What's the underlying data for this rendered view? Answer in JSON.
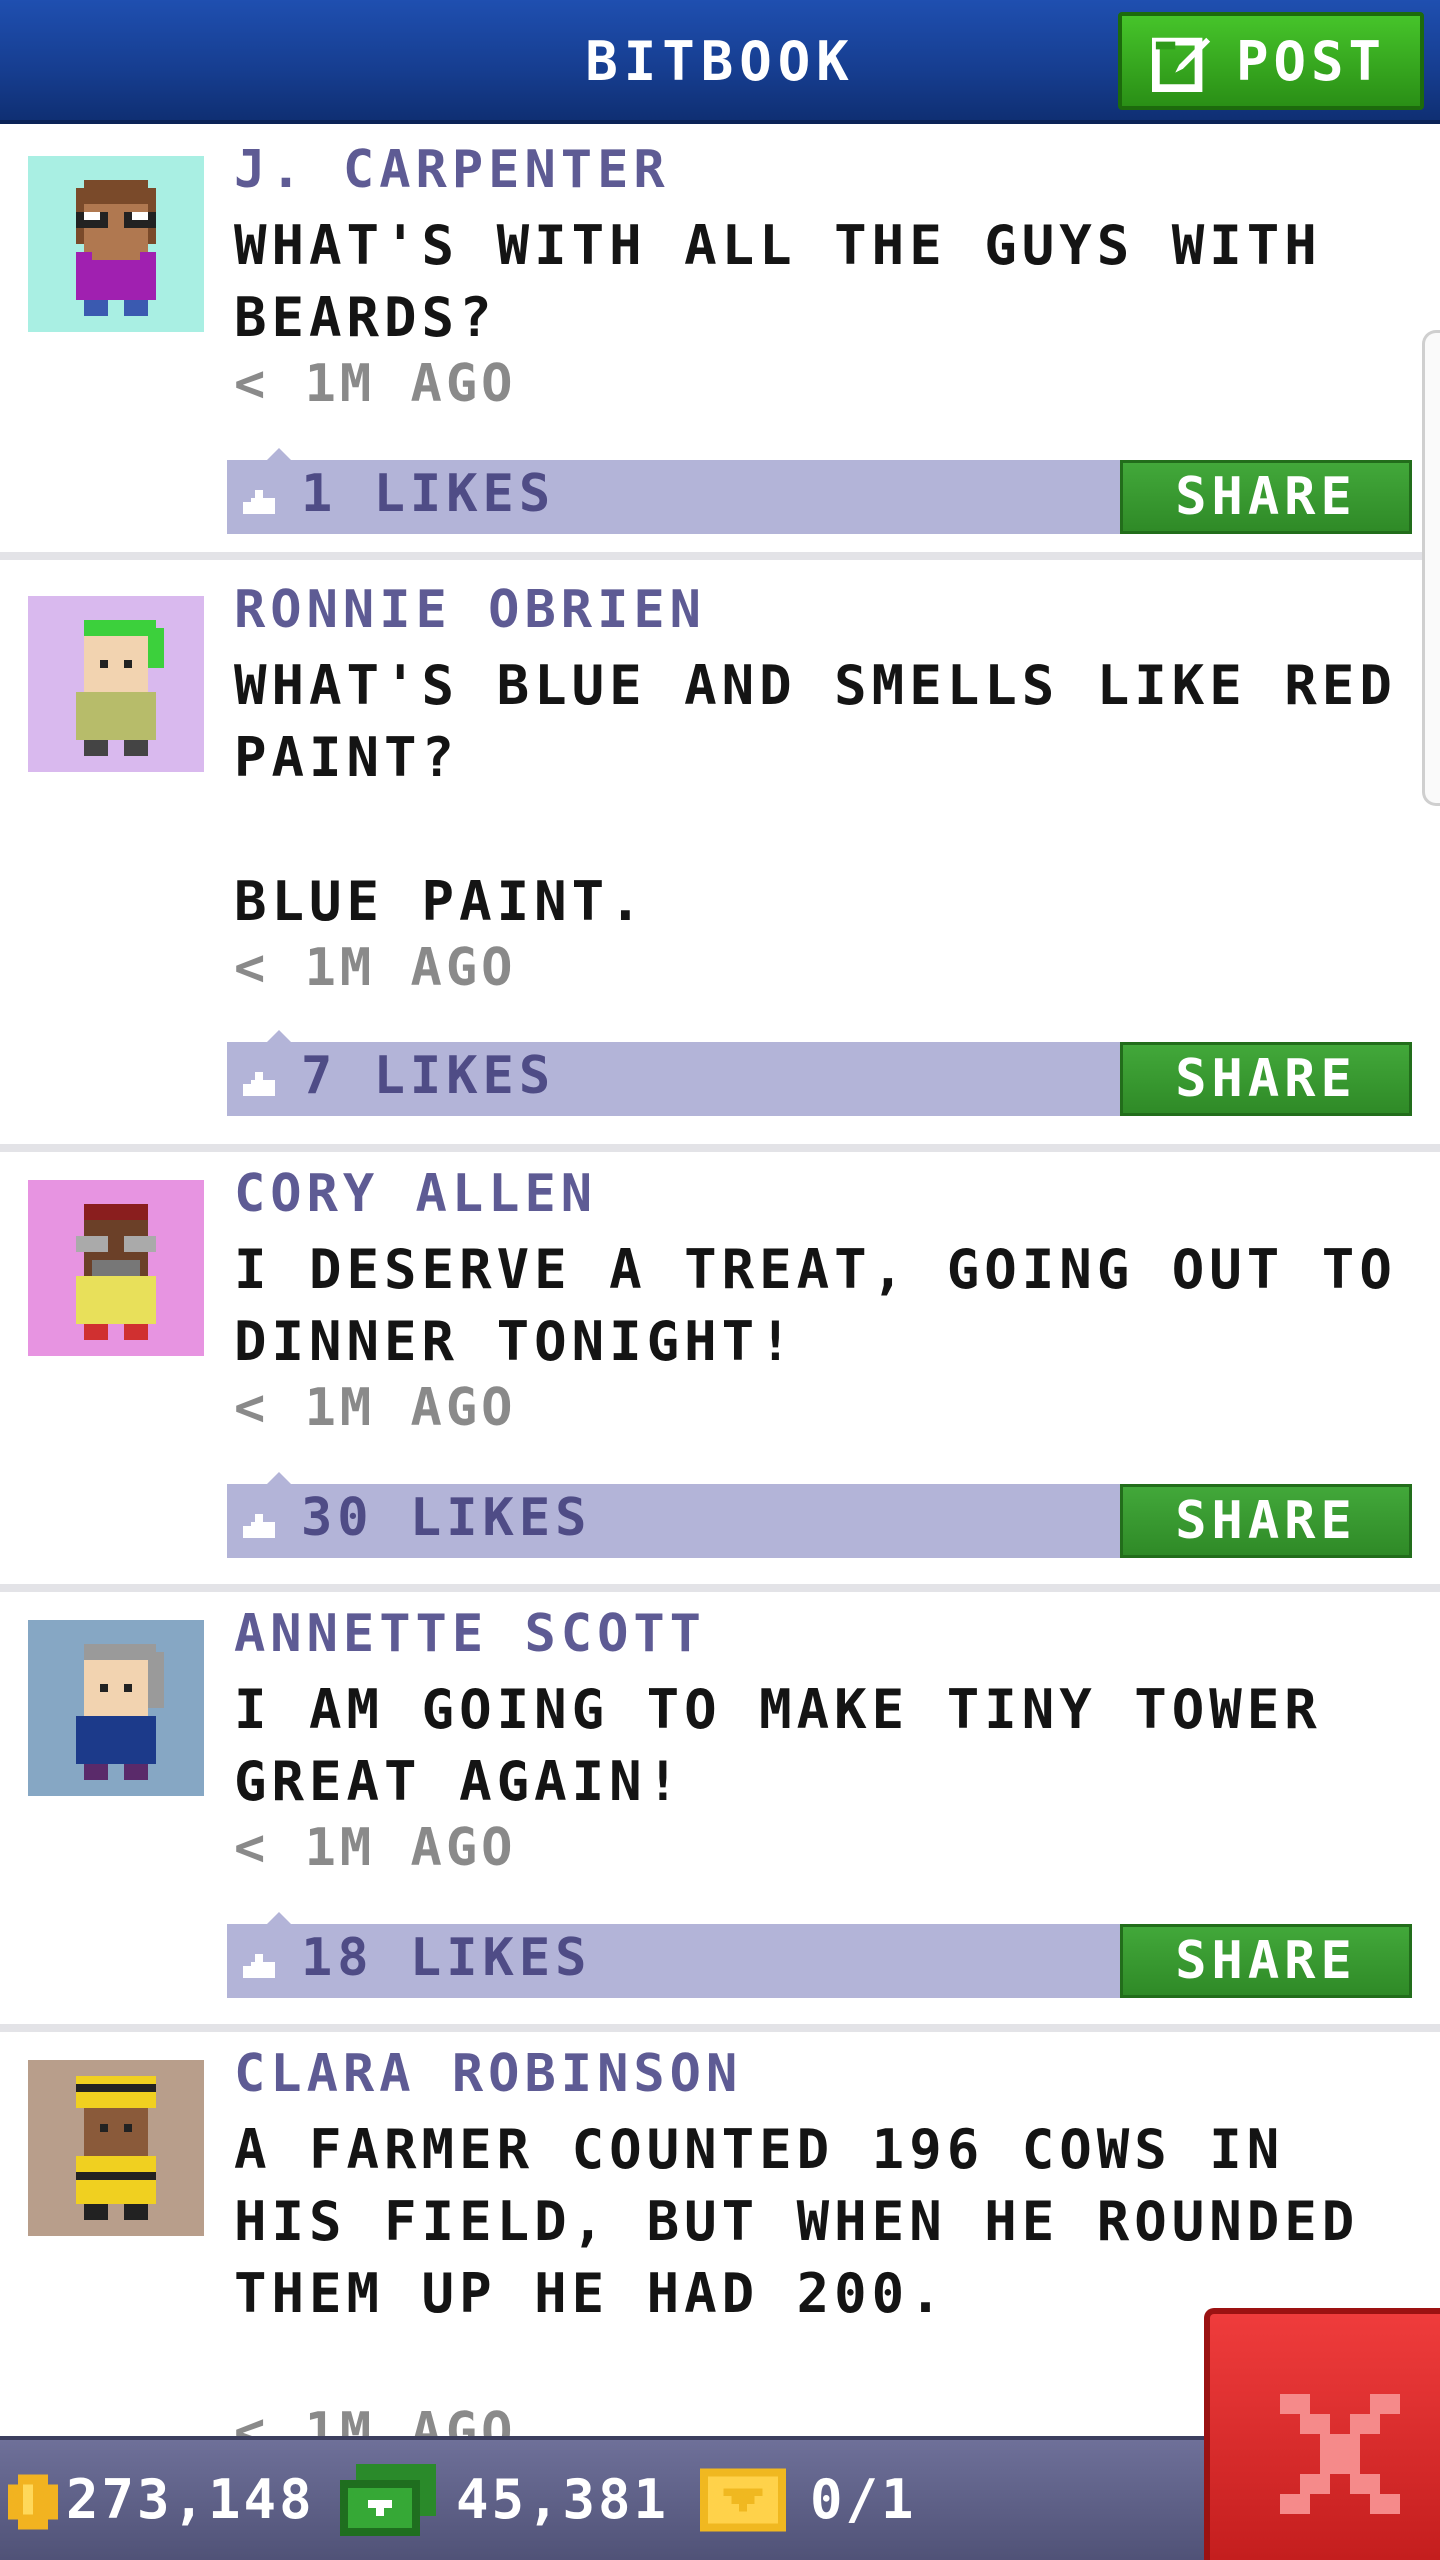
{
  "header": {
    "title": "BITBOOK",
    "post_button_label": "POST"
  },
  "posts": [
    {
      "author": "J. CARPENTER",
      "message": "WHAT'S WITH ALL THE GUYS WITH BEARDS?",
      "time": "< 1M AGO",
      "likes": "1 LIKES",
      "share_label": "SHARE",
      "avatar_bg": "#a9efe3"
    },
    {
      "author": "RONNIE OBRIEN",
      "message": "WHAT'S BLUE AND SMELLS LIKE RED PAINT?\n\nBLUE PAINT.",
      "time": "< 1M AGO",
      "likes": "7 LIKES",
      "share_label": "SHARE",
      "avatar_bg": "#d9b9ee"
    },
    {
      "author": "CORY ALLEN",
      "message": "I DESERVE A TREAT, GOING OUT TO DINNER TONIGHT!",
      "time": "< 1M AGO",
      "likes": "30 LIKES",
      "share_label": "SHARE",
      "avatar_bg": "#e794e1"
    },
    {
      "author": "ANNETTE SCOTT",
      "message": "I AM GOING TO MAKE TINY TOWER GREAT AGAIN!",
      "time": "< 1M AGO",
      "likes": "18 LIKES",
      "share_label": "SHARE",
      "avatar_bg": "#86a7c4"
    },
    {
      "author": "CLARA ROBINSON",
      "message": "A FARMER COUNTED 196 COWS IN HIS FIELD, BUT WHEN HE ROUNDED THEM UP HE HAD 200.",
      "time": "< 1M AGO",
      "avatar_bg": "#b89e8b"
    }
  ],
  "footer": {
    "coins": "273,148",
    "bux": "45,381",
    "vip": "0/1"
  },
  "colors": {
    "header": "#163d8f",
    "post_button": "#3aa81f",
    "share_button": "#3a9a31",
    "likes_bar": "#b3b4d8",
    "author_text": "#5e5b94",
    "close_button": "#d62a2a"
  },
  "icons": [
    "edit-icon",
    "like-icon",
    "coin-icon",
    "cash-icon",
    "vip-ticket-icon",
    "close-icon"
  ]
}
